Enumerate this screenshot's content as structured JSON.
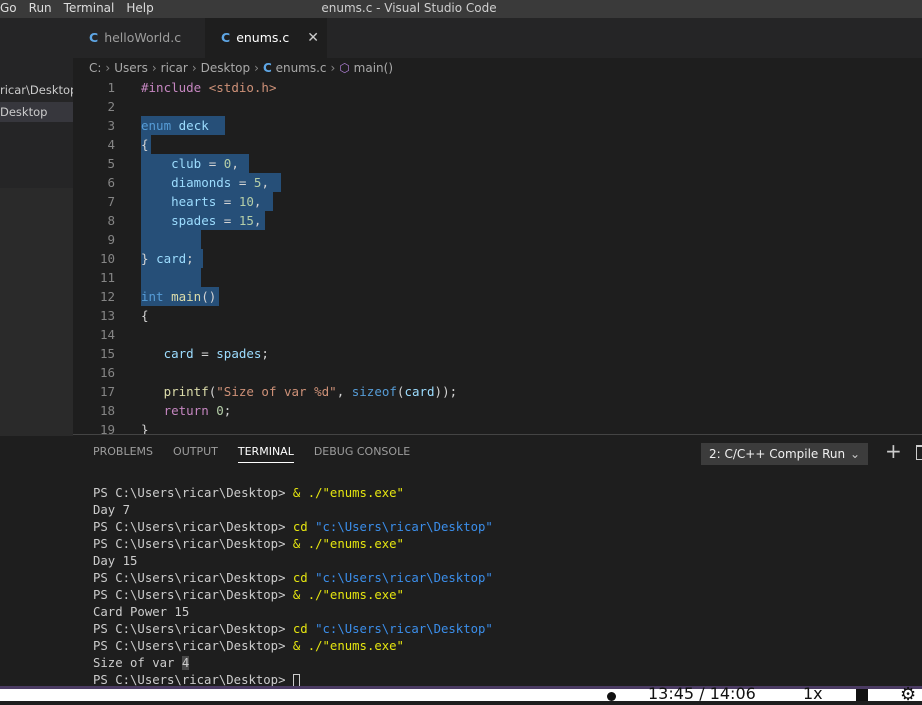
{
  "window": {
    "menu": [
      "Go",
      "Run",
      "Terminal",
      "Help"
    ],
    "title": "enums.c - Visual Studio Code"
  },
  "sidebar": {
    "items": [
      "ricar\\Desktop",
      "Desktop"
    ]
  },
  "tabs": [
    {
      "icon": "C",
      "label": "helloWorld.c",
      "active": false
    },
    {
      "icon": "C",
      "label": "enums.c",
      "active": true,
      "close": "✕"
    }
  ],
  "breadcrumb": [
    "C:",
    "Users",
    "ricar",
    "Desktop",
    "enums.c",
    "main()"
  ],
  "editor": {
    "lines": [
      {
        "n": "1"
      },
      {
        "n": "2"
      },
      {
        "n": "3"
      },
      {
        "n": "4"
      },
      {
        "n": "5"
      },
      {
        "n": "6"
      },
      {
        "n": "7"
      },
      {
        "n": "8"
      },
      {
        "n": "9"
      },
      {
        "n": "10"
      },
      {
        "n": "11"
      },
      {
        "n": "12"
      },
      {
        "n": "13"
      },
      {
        "n": "14"
      },
      {
        "n": "15"
      },
      {
        "n": "16"
      },
      {
        "n": "17"
      },
      {
        "n": "18"
      },
      {
        "n": "19"
      }
    ],
    "code": {
      "l1_inc": "#include",
      "l1_hdr": "<stdio.h>",
      "l3_kw": "enum",
      "l3_name": "deck",
      "l4": "{",
      "l5_var": "club",
      "l5_num": "0",
      "l6_var": "diamonds",
      "l6_num": "5",
      "l7_var": "hearts",
      "l7_num": "10",
      "l8_var": "spades",
      "l8_num": "15",
      "l10_close": "}",
      "l10_var": "card",
      "l12_kw": "int",
      "l12_fn": "main",
      "l13": "{",
      "l15_var": "card",
      "l15_val": "spades",
      "l17_fn": "printf",
      "l17_str": "\"Size of var %d\"",
      "l17_kw": "sizeof",
      "l17_var": "card",
      "l18_kw": "return",
      "l18_num": "0",
      "l19": "}"
    }
  },
  "panel": {
    "tabs": [
      "PROBLEMS",
      "OUTPUT",
      "TERMINAL",
      "DEBUG CONSOLE"
    ],
    "active_tab": "TERMINAL",
    "terminal_select": "2: C/C++ Compile Run",
    "terminal": {
      "prompt": "PS C:\\Users\\ricar\\Desktop>",
      "run_cmd": "& ./\"enums.exe\"",
      "cd_cmd": "cd",
      "cd_arg": "\"c:\\Users\\ricar\\Desktop\"",
      "out1": "Day 7",
      "out2": "Day 15",
      "out3": "Card Power 15",
      "out4_text": "Size of var ",
      "out4_val": "4"
    }
  },
  "video": {
    "current": "13:45",
    "sep": "/",
    "total": "14:06",
    "rate": "1x"
  }
}
